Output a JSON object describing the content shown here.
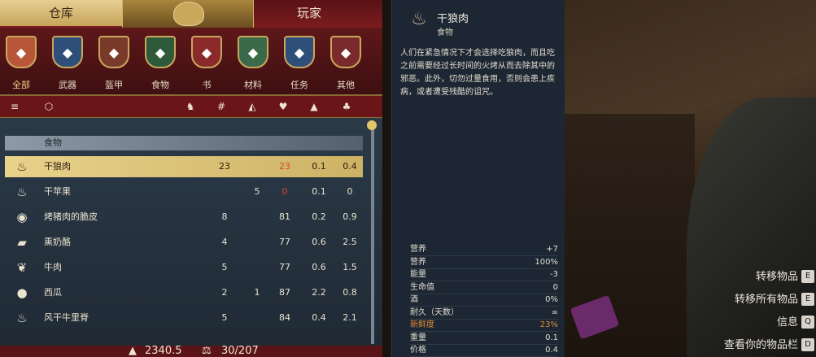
{
  "tabs": {
    "warehouse": "仓库",
    "player": "玩家"
  },
  "categories": [
    {
      "label": "全部",
      "icon": "all-items-icon",
      "color": "#b8563a"
    },
    {
      "label": "武器",
      "icon": "weapon-icon",
      "color": "#2d4f7a"
    },
    {
      "label": "盔甲",
      "icon": "armor-icon",
      "color": "#7a3a2a"
    },
    {
      "label": "食物",
      "icon": "food-icon",
      "color": "#2f5a3a"
    },
    {
      "label": "书",
      "icon": "book-icon",
      "color": "#8a2a2a"
    },
    {
      "label": "材料",
      "icon": "material-icon",
      "color": "#3a6a4a"
    },
    {
      "label": "任务",
      "icon": "quest-icon",
      "color": "#2d4f7a"
    },
    {
      "label": "其他",
      "icon": "misc-icon",
      "color": "#7a2a2a"
    }
  ],
  "section_title": "食物",
  "items": [
    {
      "name": "干狼肉",
      "icon": "dried-meat-icon",
      "glyph": "♨",
      "qty": "23",
      "player_qty": "",
      "freshness": "23",
      "weight": "0.1",
      "price": "0.4",
      "selected": true,
      "freshness_red": true
    },
    {
      "name": "干苹果",
      "icon": "dried-apple-icon",
      "glyph": "♨",
      "qty": "",
      "player_qty": "5",
      "freshness": "0",
      "weight": "0.1",
      "price": "0",
      "selected": false,
      "freshness_red": true
    },
    {
      "name": "烤猪肉的脆皮",
      "icon": "roast-pork-icon",
      "glyph": "◉",
      "qty": "8",
      "player_qty": "",
      "freshness": "81",
      "weight": "0.2",
      "price": "0.9",
      "selected": false,
      "freshness_red": false
    },
    {
      "name": "熏奶酪",
      "icon": "cheese-icon",
      "glyph": "▰",
      "qty": "4",
      "player_qty": "",
      "freshness": "77",
      "weight": "0.6",
      "price": "2.5",
      "selected": false,
      "freshness_red": false
    },
    {
      "name": "牛肉",
      "icon": "beef-icon",
      "glyph": "❦",
      "qty": "5",
      "player_qty": "",
      "freshness": "77",
      "weight": "0.6",
      "price": "1.5",
      "selected": false,
      "freshness_red": false
    },
    {
      "name": "西瓜",
      "icon": "watermelon-icon",
      "glyph": "●",
      "qty": "2",
      "player_qty": "1",
      "freshness": "87",
      "weight": "2.2",
      "price": "0.8",
      "selected": false,
      "freshness_red": false
    },
    {
      "name": "风干牛里脊",
      "icon": "dried-beef-icon",
      "glyph": "♨",
      "qty": "5",
      "player_qty": "",
      "freshness": "84",
      "weight": "0.4",
      "price": "2.1",
      "selected": false,
      "freshness_red": false
    }
  ],
  "status": {
    "money": "2340.5",
    "weight": "30/207"
  },
  "detail": {
    "name": "干狼肉",
    "type": "食物",
    "description": "人们在紧急情况下才会选择吃狼肉，而且吃之前需要经过长时间的火烤从而去除其中的邪恶。此外，切勿过量食用，否则会患上疾病，或者遭受残酷的诅咒。",
    "stats": [
      {
        "label": "营养",
        "value": "+7"
      },
      {
        "label": "营养",
        "value": "100%"
      },
      {
        "label": "能量",
        "value": "-3"
      },
      {
        "label": "生命值",
        "value": "0"
      },
      {
        "label": "酒",
        "value": "0%"
      },
      {
        "label": "耐久（天数）",
        "value": "∞"
      },
      {
        "label": "新鲜度",
        "value": "23%",
        "highlight": true
      },
      {
        "label": "重量",
        "value": "0.1"
      },
      {
        "label": "价格",
        "value": "0.4"
      }
    ]
  },
  "hints": [
    {
      "label": "转移物品",
      "key": "E"
    },
    {
      "label": "转移所有物品",
      "key": "E"
    },
    {
      "label": "信息",
      "key": "Q"
    },
    {
      "label": "查看你的物品栏",
      "key": "D"
    }
  ]
}
